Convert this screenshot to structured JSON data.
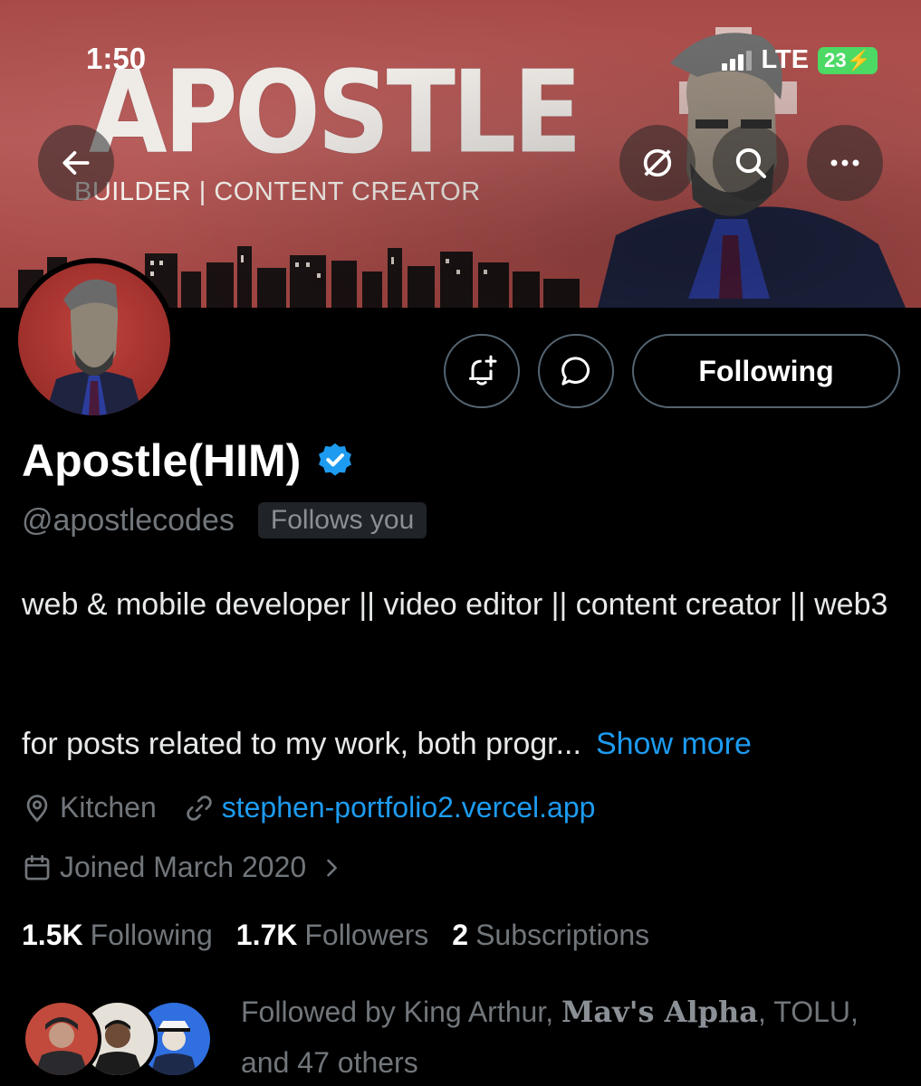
{
  "status_bar": {
    "time": "1:50",
    "network": "LTE",
    "battery": "23"
  },
  "banner": {
    "title": "APOSTLE",
    "subtitle": "BUILDER | CONTENT CREATOR"
  },
  "profile": {
    "display_name": "Apostle(HIM)",
    "handle": "@apostlecodes",
    "follows_you": "Follows you",
    "bio_line1": "web & mobile developer || video editor || content creator || web3",
    "bio_line2": "for posts related to my work, both progr...",
    "show_more": "Show more",
    "location": "Kitchen",
    "website": "stephen-portfolio2.vercel.app",
    "joined": "Joined March 2020",
    "following_count": "1.5K",
    "following_label": "Following",
    "followers_count": "1.7K",
    "followers_label": "Followers",
    "subscriptions_count": "2",
    "subscriptions_label": "Subscriptions",
    "followed_by_prefix": "Followed by King Arthur, ",
    "followed_by_mav": "Mav's Alpha",
    "followed_by_suffix": ", TOLU,",
    "followed_by_others": "and 47 others"
  },
  "actions": {
    "following_button": "Following"
  },
  "colors": {
    "accent": "#1d9bf0",
    "banner_red": "#b45654",
    "verified": "#1d9bf0"
  }
}
